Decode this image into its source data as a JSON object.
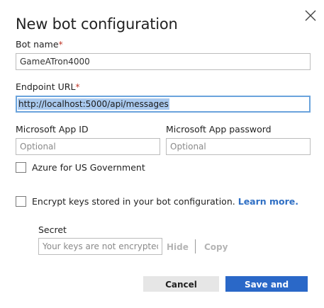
{
  "dialog": {
    "title": "New bot configuration"
  },
  "fields": {
    "bot_name": {
      "label": "Bot name",
      "required_mark": "*",
      "value": "GameATron4000"
    },
    "endpoint_url": {
      "label": "Endpoint URL",
      "required_mark": "*",
      "value": "http://localhost:5000/api/messages"
    },
    "app_id": {
      "label": "Microsoft App ID",
      "placeholder": "Optional",
      "value": ""
    },
    "app_password": {
      "label": "Microsoft App password",
      "placeholder": "Optional",
      "value": ""
    }
  },
  "azure_gov": {
    "label": "Azure for US Government",
    "checked": false
  },
  "encrypt": {
    "label": "Encrypt keys stored in your bot configuration.",
    "link": "Learn more.",
    "checked": false
  },
  "secret": {
    "label": "Secret",
    "placeholder": "Your keys are not encrypted",
    "hide_label": "Hide",
    "copy_label": "Copy"
  },
  "actions": {
    "cancel_label": "Cancel",
    "submit_label": "Save and connect"
  },
  "colors": {
    "primary": "#2a68c8",
    "link": "#2f6fc4",
    "focus_border": "#6aa3dc",
    "selection": "#a9c9ee",
    "required": "#c0392b"
  },
  "icons": {
    "close": "close-icon"
  }
}
